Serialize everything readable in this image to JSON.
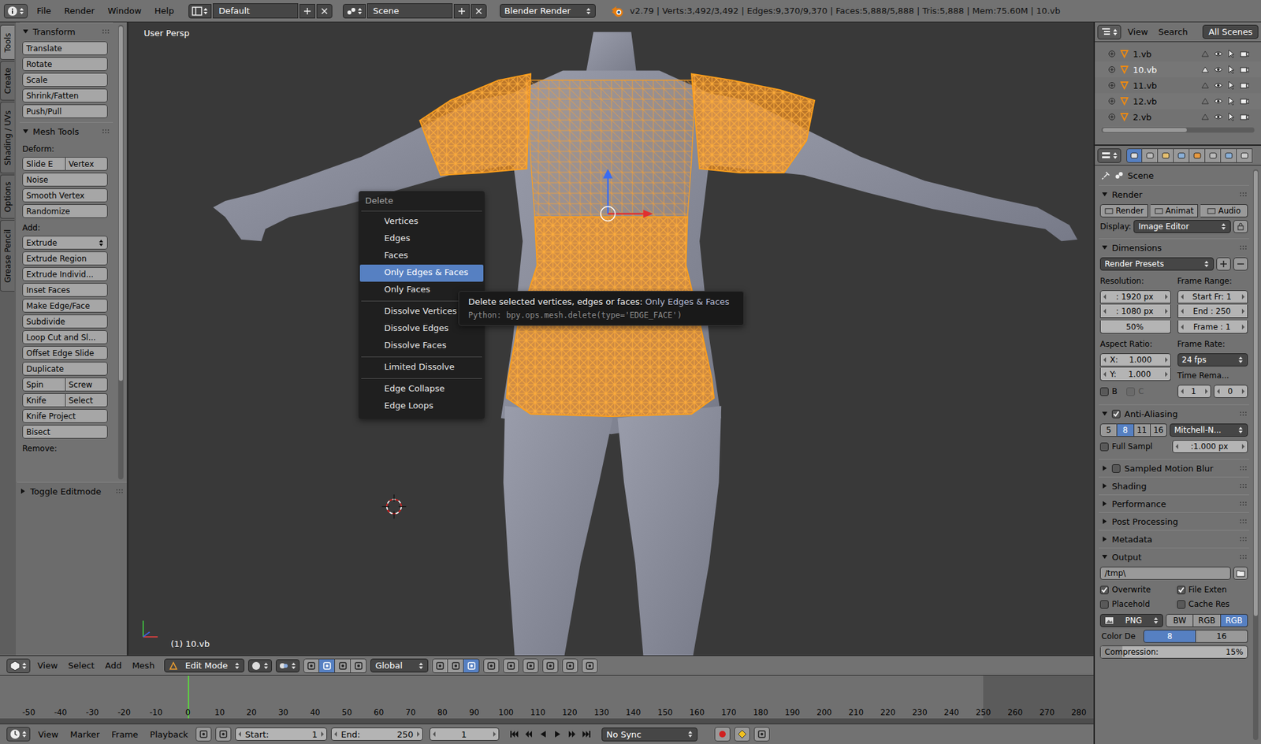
{
  "header": {
    "menus": [
      "File",
      "Render",
      "Window",
      "Help"
    ],
    "screen": "Default",
    "scene": "Scene",
    "engine": "Blender Render",
    "stats": "v2.79 | Verts:3,492/3,492 | Edges:9,370/9,370 | Faces:5,888/5,888 | Tris:5,888 | Mem:75.60M | 10.vb"
  },
  "tool_tabs": [
    {
      "label": "Tools",
      "selected": true
    },
    {
      "label": "Create",
      "selected": false
    },
    {
      "label": "Shading / UVs",
      "selected": false
    },
    {
      "label": "Options",
      "selected": false
    },
    {
      "label": "Grease Pencil",
      "selected": false
    }
  ],
  "tool_shelf": {
    "panels": [
      {
        "title": "Transform",
        "expanded": true,
        "sections": [
          {
            "rows": [
              [
                {
                  "label": "Translate",
                  "kind": "button"
                }
              ],
              [
                {
                  "label": "Rotate",
                  "kind": "button"
                }
              ],
              [
                {
                  "label": "Scale",
                  "kind": "button"
                }
              ],
              [
                {
                  "label": "Shrink/Fatten",
                  "kind": "button"
                }
              ],
              [
                {
                  "label": "Push/Pull",
                  "kind": "button"
                }
              ]
            ]
          }
        ]
      },
      {
        "title": "Mesh Tools",
        "expanded": true,
        "sections": [
          {
            "label": "Deform:",
            "rows": [
              [
                {
                  "label": "Slide E",
                  "kind": "button"
                },
                {
                  "label": "Vertex",
                  "kind": "button"
                }
              ],
              [
                {
                  "label": "Noise",
                  "kind": "button"
                }
              ],
              [
                {
                  "label": "Smooth Vertex",
                  "kind": "button"
                }
              ],
              [
                {
                  "label": "Randomize",
                  "kind": "button"
                }
              ]
            ]
          },
          {
            "label": "Add:",
            "rows": [
              [
                {
                  "label": "Extrude",
                  "kind": "dropdown"
                }
              ],
              [
                {
                  "label": "Extrude Region",
                  "kind": "button"
                }
              ],
              [
                {
                  "label": "Extrude Individ...",
                  "kind": "button"
                }
              ],
              [
                {
                  "label": "Inset Faces",
                  "kind": "button"
                }
              ],
              [
                {
                  "label": "Make Edge/Face",
                  "kind": "button"
                }
              ],
              [
                {
                  "label": "Subdivide",
                  "kind": "button"
                }
              ],
              [
                {
                  "label": "Loop Cut and Sl...",
                  "kind": "button"
                }
              ],
              [
                {
                  "label": "Offset Edge Slide",
                  "kind": "button"
                }
              ],
              [
                {
                  "label": "Duplicate",
                  "kind": "button"
                }
              ],
              [
                {
                  "label": "Spin",
                  "kind": "button"
                },
                {
                  "label": "Screw",
                  "kind": "button"
                }
              ],
              [
                {
                  "label": "Knife",
                  "kind": "button"
                },
                {
                  "label": "Select",
                  "kind": "button"
                }
              ],
              [
                {
                  "label": "Knife Project",
                  "kind": "button"
                }
              ],
              [
                {
                  "label": "Bisect",
                  "kind": "button"
                }
              ]
            ]
          },
          {
            "label": "Remove:",
            "rows": []
          }
        ]
      }
    ],
    "operator_panel": {
      "title": "Toggle Editmode",
      "expanded": false
    }
  },
  "viewport": {
    "view_name": "User Persp",
    "object_info": "(1) 10.vb"
  },
  "delete_menu": {
    "title": "Delete",
    "groups": [
      [
        {
          "label": "Vertices",
          "selected": false
        },
        {
          "label": "Edges",
          "selected": false
        },
        {
          "label": "Faces",
          "selected": false
        },
        {
          "label": "Only Edges & Faces",
          "selected": true
        },
        {
          "label": "Only Faces",
          "selected": false
        }
      ],
      [
        {
          "label": "Dissolve Vertices",
          "selected": false
        },
        {
          "label": "Dissolve Edges",
          "selected": false
        },
        {
          "label": "Dissolve Faces",
          "selected": false
        }
      ],
      [
        {
          "label": "Limited Dissolve",
          "selected": false
        }
      ],
      [
        {
          "label": "Edge Collapse",
          "selected": false
        },
        {
          "label": "Edge Loops",
          "selected": false
        }
      ]
    ]
  },
  "tooltip": {
    "description": "Delete selected vertices, edges or faces:",
    "value": "Only Edges & Faces",
    "python": "Python: bpy.ops.mesh.delete(type='EDGE_FACE')"
  },
  "view3d_header": {
    "menus": [
      "View",
      "Select",
      "Add",
      "Mesh"
    ],
    "mode": "Edit Mode",
    "orientation": "Global",
    "manipulators": [
      {
        "selected": false
      },
      {
        "selected": true
      },
      {
        "selected": false
      },
      {
        "selected": false
      }
    ],
    "select_modes": [
      {
        "selected": false
      },
      {
        "selected": false
      },
      {
        "selected": true
      }
    ]
  },
  "timeline": {
    "ticks": [
      "-50",
      "-40",
      "-30",
      "-20",
      "-10",
      "0",
      "10",
      "20",
      "30",
      "40",
      "50",
      "60",
      "70",
      "80",
      "90",
      "100",
      "110",
      "120",
      "130",
      "140",
      "150",
      "160",
      "170",
      "180",
      "190",
      "200",
      "210",
      "220",
      "230",
      "240",
      "250",
      "260",
      "270",
      "280"
    ],
    "current_frame": 0
  },
  "timeline_header": {
    "menus": [
      "View",
      "Marker",
      "Frame",
      "Playback"
    ],
    "start_label": "Start:",
    "start": "1",
    "end_label": "End:",
    "end": "250",
    "frame": "1",
    "sync": "No Sync"
  },
  "outliner": {
    "menus": [
      "View",
      "Search"
    ],
    "display_mode": "All Scenes",
    "items": [
      {
        "name": "1.vb",
        "selected": false
      },
      {
        "name": "10.vb",
        "selected": true
      },
      {
        "name": "11.vb",
        "selected": false
      },
      {
        "name": "12.vb",
        "selected": false
      },
      {
        "name": "2.vb",
        "selected": false
      }
    ]
  },
  "properties": {
    "tabs": [
      {
        "selected": true
      },
      {
        "selected": false
      },
      {
        "selected": false
      },
      {
        "selected": false
      },
      {
        "selected": false
      },
      {
        "selected": false
      },
      {
        "selected": false
      },
      {
        "selected": false
      }
    ],
    "context": "Scene",
    "render": {
      "title": "Render",
      "expanded": true,
      "buttons": [
        "Render",
        "Animat",
        "Audio"
      ],
      "display_label": "Display:",
      "display": "Image Editor"
    },
    "dimensions": {
      "title": "Dimensions",
      "expanded": true,
      "presets": "Render Presets",
      "resolution_label": "Resolution:",
      "resolution_x": ": 1920 px",
      "resolution_y": ": 1080 px",
      "resolution_percent": "50%",
      "frame_range_label": "Frame Range:",
      "frame_start": "Start Fr: 1",
      "frame_end": "End : 250",
      "frame_current": "Frame : 1",
      "aspect_label": "Aspect Ratio:",
      "aspect_x": {
        "label": "X:",
        "value": "1.000"
      },
      "aspect_y": {
        "label": "Y:",
        "value": "1.000"
      },
      "frame_rate_label": "Frame Rate:",
      "frame_rate": "24 fps",
      "time_label": "Time Rema...",
      "time_old": "1",
      "time_new": "0",
      "border": {
        "label": "B",
        "checked": false,
        "disabled": false
      },
      "crop": {
        "label": "C",
        "checked": false,
        "disabled": true
      }
    },
    "anti_aliasing": {
      "title": "Anti-Aliasing",
      "expanded": true,
      "checked": true,
      "samples": [
        {
          "label": "5",
          "selected": false
        },
        {
          "label": "8",
          "selected": true
        },
        {
          "label": "11",
          "selected": false
        },
        {
          "label": "16",
          "selected": false
        }
      ],
      "filter": "Mitchell-N...",
      "full_sample": {
        "label": "Full Sampl",
        "checked": false
      },
      "filter_size": ":1.000 px"
    },
    "collapsed_panels": [
      {
        "title": "Sampled Motion Blur",
        "kind": "checkbox",
        "checked": false,
        "expanded": false
      },
      {
        "title": "Shading",
        "kind": "plain",
        "expanded": false
      },
      {
        "title": "Performance",
        "kind": "plain",
        "expanded": false
      },
      {
        "title": "Post Processing",
        "kind": "plain",
        "expanded": false
      },
      {
        "title": "Metadata",
        "kind": "plain",
        "expanded": false
      }
    ],
    "output": {
      "title": "Output",
      "expanded": true,
      "path": "/tmp\\",
      "options": [
        {
          "label": "Overwrite",
          "checked": true
        },
        {
          "label": "File Exten",
          "checked": true
        },
        {
          "label": "Placehold",
          "checked": false
        },
        {
          "label": "Cache Res",
          "checked": false
        }
      ],
      "format": "PNG",
      "color_modes": [
        {
          "label": "BW",
          "selected": false
        },
        {
          "label": "RGB",
          "selected": false
        },
        {
          "label": "RGB",
          "selected": true
        }
      ],
      "color_depth_label": "Color De",
      "color_depths": [
        {
          "label": "8",
          "selected": true
        },
        {
          "label": "16",
          "selected": false
        }
      ],
      "compression_label": "Compression:",
      "compression_value": "15%",
      "compression_level": 0.15
    }
  }
}
